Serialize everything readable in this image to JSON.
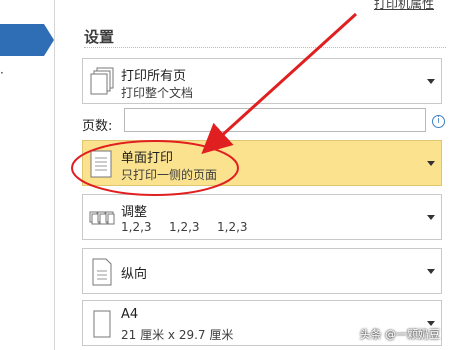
{
  "header": {
    "printer_properties_link": "打印机属性"
  },
  "nav": {
    "fragment": "·"
  },
  "settings": {
    "title": "设置",
    "print_range": {
      "line1": "打印所有页",
      "line2": "打印整个文档"
    },
    "pages": {
      "label": "页数:",
      "value": "",
      "info_icon": "info-icon"
    },
    "sides": {
      "line1": "单面打印",
      "line2": "只打印一侧的页面"
    },
    "collate": {
      "line1": "调整",
      "values": [
        "1,2,3",
        "1,2,3",
        "1,2,3"
      ]
    },
    "orientation": {
      "line1": "纵向"
    },
    "paper": {
      "line1": "A4",
      "line2": "21 厘米 x 29.7 厘米"
    }
  },
  "watermark": "头条 @一颗奶豆",
  "colors": {
    "accent_nav": "#2f6db5",
    "selected_bg": "#fbe28f",
    "annotation": "#e02020"
  }
}
